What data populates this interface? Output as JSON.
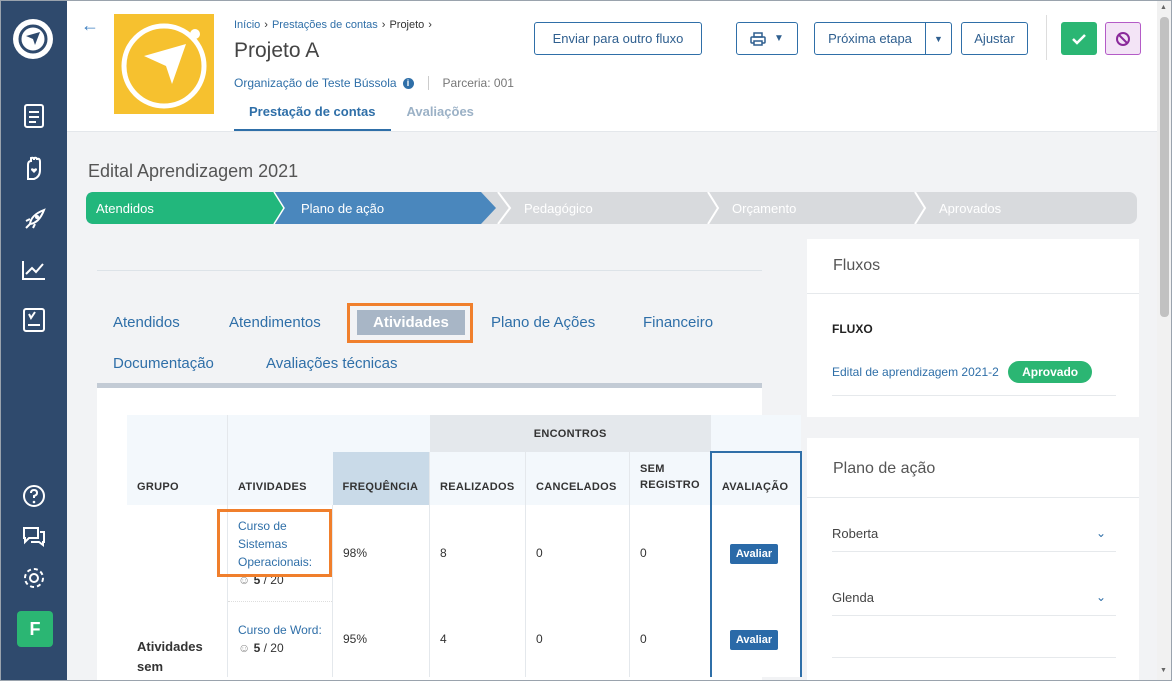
{
  "sidebar": {
    "icons": [
      "logo-icon",
      "document-icon",
      "hand-heart-icon",
      "rocket-icon",
      "chart-line-icon",
      "board-icon",
      "help-icon",
      "chat-icon",
      "gear-icon"
    ],
    "avatar_letter": "F"
  },
  "breadcrumb": {
    "home": "Início",
    "accounts": "Prestações de contas",
    "current": "Projeto"
  },
  "project": {
    "title": "Projeto A",
    "organization": "Organização de Teste Bússola",
    "partnership": "Parceria: 001"
  },
  "header_tabs": [
    "Prestação de contas",
    "Avaliações"
  ],
  "actions": {
    "send_flow": "Enviar para outro fluxo",
    "next_step": "Próxima etapa",
    "adjust": "Ajustar"
  },
  "edital_title": "Edital Aprendizagem 2021",
  "stepper": [
    "Atendidos",
    "Plano de ação",
    "Pedagógico",
    "Orçamento",
    "Aprovados"
  ],
  "content_tabs": {
    "row1": [
      "Atendidos",
      "Atendimentos",
      "Atividades",
      "Plano de Ações",
      "Financeiro"
    ],
    "row2": [
      "Documentação",
      "Avaliações técnicas"
    ]
  },
  "table": {
    "encontros_label": "ENCONTROS",
    "headers": [
      "GRUPO",
      "ATIVIDADES",
      "FREQUÊNCIA",
      "REALIZADOS",
      "CANCELADOS",
      "SEM REGISTRO",
      "AVALIAÇÃO"
    ],
    "group_label": "Atividades sem",
    "rows": [
      {
        "activity": "Curso de Sistemas Operacionais:",
        "participants": "5",
        "capacity": "/ 20",
        "frequency": "98%",
        "realizados": "8",
        "cancelados": "0",
        "sem_registro": "0",
        "action": "Avaliar"
      },
      {
        "activity": "Curso de Word:",
        "participants": "5",
        "capacity": "/ 20",
        "frequency": "95%",
        "realizados": "4",
        "cancelados": "0",
        "sem_registro": "0",
        "action": "Avaliar"
      }
    ]
  },
  "fluxos": {
    "title": "Fluxos",
    "column": "FLUXO",
    "item": "Edital de aprendizagem 2021-2",
    "status": "Aprovado"
  },
  "plano": {
    "title": "Plano de ação",
    "items": [
      "Roberta",
      "Glenda"
    ]
  },
  "colors": {
    "sidebar": "#2f4a6d",
    "accent": "#2f6fa8",
    "green": "#2bb673",
    "highlight": "#f07f2c"
  }
}
